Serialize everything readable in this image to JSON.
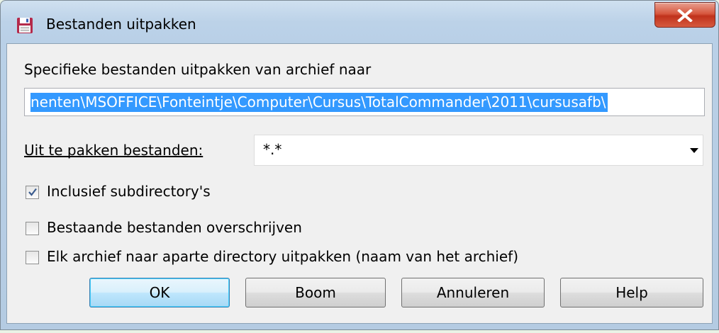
{
  "window": {
    "title": "Bestanden uitpakken",
    "icon": "floppy-disk-icon",
    "close_icon": "close-icon"
  },
  "dialog": {
    "target_label": "Specifieke bestanden uitpakken van archief naar",
    "target_path": "nenten\\MSOFFICE\\Fonteintje\\Computer\\Cursus\\TotalCommander\\2011\\cursusafb\\",
    "files_label": "Uit te pakken bestanden:",
    "files_value": "*.*",
    "options": [
      {
        "label": "Inclusief subdirectory's",
        "checked": true
      },
      {
        "label": "Bestaande bestanden overschrijven",
        "checked": false
      },
      {
        "label": "Elk archief naar aparte directory uitpakken (naam van het archief)",
        "checked": false
      }
    ],
    "buttons": {
      "ok": "OK",
      "tree": "Boom",
      "cancel": "Annuleren",
      "help": "Help"
    }
  },
  "colors": {
    "selection": "#3399ff",
    "close_button": "#c7432b",
    "default_button_border": "#3c7fb1"
  }
}
